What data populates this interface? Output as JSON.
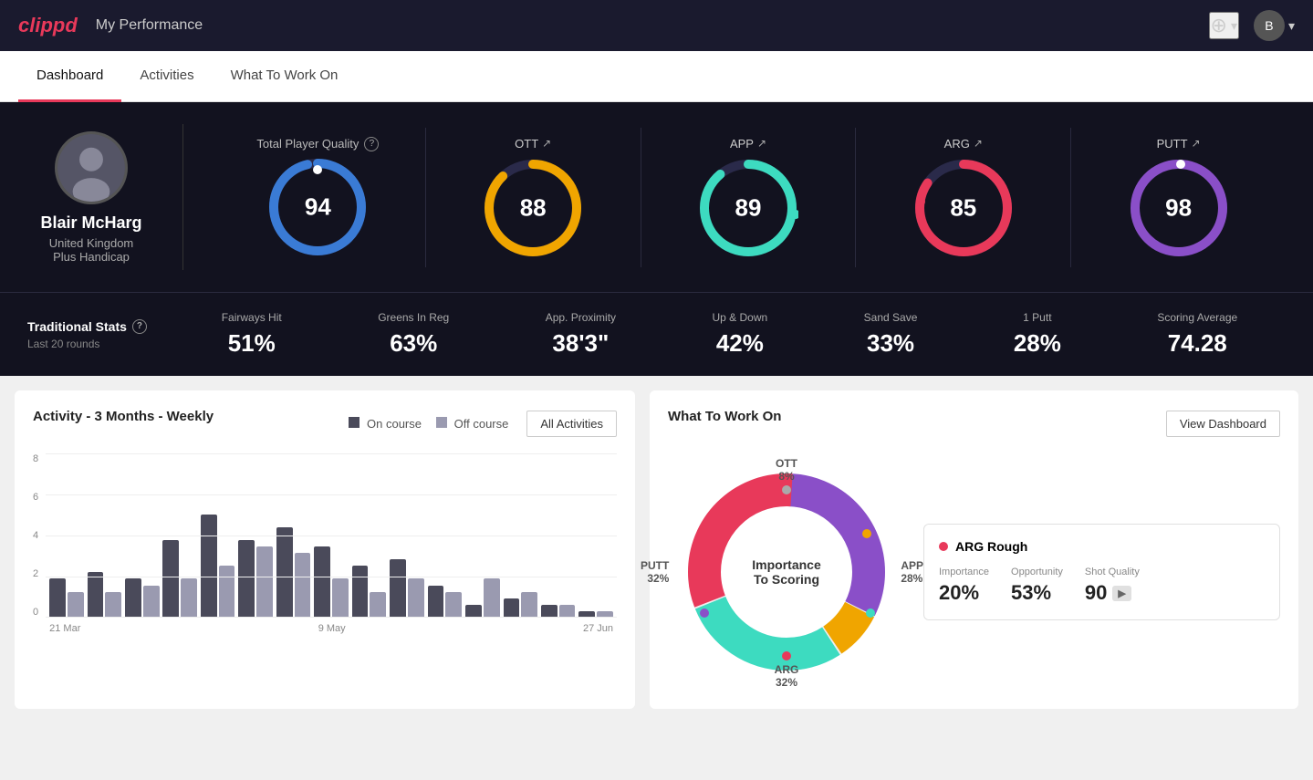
{
  "header": {
    "logo": "clippd",
    "title": "My Performance",
    "add_icon": "⊕",
    "chevron_down": "▾"
  },
  "nav": {
    "tabs": [
      {
        "label": "Dashboard",
        "active": true
      },
      {
        "label": "Activities",
        "active": false
      },
      {
        "label": "What To Work On",
        "active": false
      }
    ]
  },
  "player": {
    "name": "Blair McHarg",
    "country": "United Kingdom",
    "handicap": "Plus Handicap",
    "avatar_initial": "B"
  },
  "total_quality": {
    "label": "Total Player Quality",
    "value": 94,
    "color": "#3a7bd5"
  },
  "metrics": [
    {
      "id": "ott",
      "label": "OTT",
      "value": 88,
      "color": "#f0a500"
    },
    {
      "id": "app",
      "label": "APP",
      "value": 89,
      "color": "#3ddbc0"
    },
    {
      "id": "arg",
      "label": "ARG",
      "value": 85,
      "color": "#e8395a"
    },
    {
      "id": "putt",
      "label": "PUTT",
      "value": 98,
      "color": "#8a4fc8"
    }
  ],
  "traditional_stats": {
    "label": "Traditional Stats",
    "sub": "Last 20 rounds",
    "items": [
      {
        "name": "Fairways Hit",
        "value": "51%"
      },
      {
        "name": "Greens In Reg",
        "value": "63%"
      },
      {
        "name": "App. Proximity",
        "value": "38'3\""
      },
      {
        "name": "Up & Down",
        "value": "42%"
      },
      {
        "name": "Sand Save",
        "value": "33%"
      },
      {
        "name": "1 Putt",
        "value": "28%"
      },
      {
        "name": "Scoring Average",
        "value": "74.28"
      }
    ]
  },
  "activity_chart": {
    "title": "Activity - 3 Months - Weekly",
    "legend": [
      {
        "label": "On course",
        "style": "dark"
      },
      {
        "label": "Off course",
        "style": "light"
      }
    ],
    "all_activities_btn": "All Activities",
    "x_labels": [
      "21 Mar",
      "9 May",
      "27 Jun"
    ],
    "y_labels": [
      "8",
      "6",
      "4",
      "2",
      "0"
    ],
    "bars": [
      {
        "dark": 30,
        "light": 20
      },
      {
        "dark": 35,
        "light": 20
      },
      {
        "dark": 30,
        "light": 25
      },
      {
        "dark": 60,
        "light": 30
      },
      {
        "dark": 80,
        "light": 40
      },
      {
        "dark": 60,
        "light": 55
      },
      {
        "dark": 70,
        "light": 50
      },
      {
        "dark": 55,
        "light": 30
      },
      {
        "dark": 40,
        "light": 20
      },
      {
        "dark": 45,
        "light": 30
      },
      {
        "dark": 25,
        "light": 20
      },
      {
        "dark": 10,
        "light": 30
      },
      {
        "dark": 15,
        "light": 20
      },
      {
        "dark": 10,
        "light": 10
      },
      {
        "dark": 5,
        "light": 5
      }
    ]
  },
  "what_to_work_on": {
    "title": "What To Work On",
    "view_dashboard_btn": "View Dashboard",
    "donut_label_line1": "Importance",
    "donut_label_line2": "To Scoring",
    "segments": [
      {
        "label": "OTT",
        "percent": "8%",
        "color": "#f0a500"
      },
      {
        "label": "APP",
        "percent": "28%",
        "color": "#3ddbc0"
      },
      {
        "label": "ARG",
        "percent": "32%",
        "color": "#e8395a"
      },
      {
        "label": "PUTT",
        "percent": "32%",
        "color": "#8a4fc8"
      }
    ],
    "info_card": {
      "title": "ARG Rough",
      "dot_color": "#e8395a",
      "metrics": [
        {
          "label": "Importance",
          "value": "20%"
        },
        {
          "label": "Opportunity",
          "value": "53%"
        },
        {
          "label": "Shot Quality",
          "value": "90"
        }
      ]
    }
  }
}
